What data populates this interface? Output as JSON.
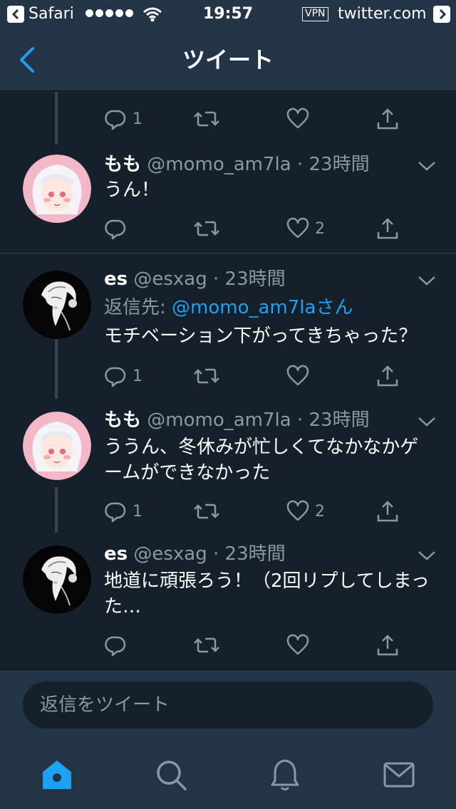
{
  "status_bar": {
    "back_app": "Safari",
    "time": "19:57",
    "vpn": "VPN",
    "url": "twitter.com"
  },
  "nav": {
    "title": "ツイート"
  },
  "tweets": [
    {
      "name": "もも",
      "handle": "@momo_am7la",
      "time": "23時間",
      "text": "うん！",
      "reply_count": "",
      "like_count": "2",
      "avatar": "momo"
    },
    {
      "name": "es",
      "handle": "@esxag",
      "time": "23時間",
      "reply_to_label": "返信先:",
      "reply_to_handle": "@momo_am7la",
      "reply_to_suffix": "さん",
      "text": "モチベーション下がってきちゃった？",
      "reply_count": "1",
      "like_count": "",
      "avatar": "es"
    },
    {
      "name": "もも",
      "handle": "@momo_am7la",
      "time": "23時間",
      "text_line1": "ううん、冬休みが忙しくてなかなかゲ",
      "text_line2": "ームができなかった",
      "reply_count": "1",
      "like_count": "2",
      "avatar": "momo"
    },
    {
      "name": "es",
      "handle": "@esxag",
      "time": "23時間",
      "text_line1": "地道に頑張ろう！（2回リプしてしまっ",
      "text_line2": "た…",
      "reply_count": "",
      "like_count": "",
      "avatar": "es"
    }
  ],
  "partial_tweet": {
    "reply_count": "1"
  },
  "composer": {
    "placeholder": "返信をツイート"
  },
  "tabs": [
    "home-icon",
    "search-icon",
    "notifications-icon",
    "messages-icon"
  ],
  "colors": {
    "background": "#15202b",
    "bars": "#243447",
    "accent": "#1da1f2",
    "secondary_text": "#8899a6",
    "divider": "#38444d"
  }
}
